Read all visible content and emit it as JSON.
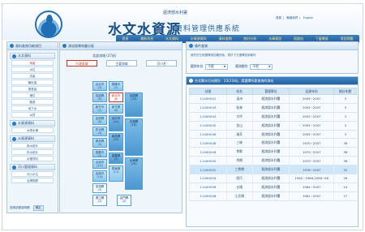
{
  "header": {
    "agency": "經濟部水利署",
    "title_main": "水文水資源",
    "title_sub": "資料管理供應系統",
    "top_links": [
      "首頁",
      "聯絡我們",
      "English"
    ],
    "menu": [
      "首頁",
      "最新消息",
      "水文資料",
      "水資源資料",
      "資料查詢",
      "統計分析",
      "水庫資訊",
      "雨量站",
      "下載專區",
      "常見問題"
    ]
  },
  "nav": {
    "title": "資料查詢功能項目",
    "groups": [
      {
        "title": "水文資料",
        "items": [
          "雨量",
          "水位",
          "流量",
          "輸砂量",
          "蒸發量",
          "潮位",
          "颱風",
          "地下水",
          "水質"
        ],
        "active_index": 0
      },
      {
        "title": "水資源資料",
        "items": [
          "水庫水情"
        ]
      },
      {
        "title": "水資源資料",
        "items": [
          "用水統計",
          "供水統計",
          "水權資料"
        ]
      },
      {
        "title": "河川管理資料",
        "items": [
          "河川水位",
          "治理規劃"
        ]
      }
    ],
    "footer_text": "查詢站號及時間",
    "footer_button": "確定"
  },
  "mid": {
    "title": "測站搜尋地圖分區",
    "basin_label": "北部流域 (27站)",
    "tabs": [
      "行政區域",
      "主要流域",
      "河川名"
    ],
    "active_tab": 0,
    "tiles": [
      {
        "name": "台北市",
        "count": "(3)"
      },
      {
        "name": "基隆市",
        "count": "(1)"
      },
      {
        "name": "桃園縣",
        "count": "(5)"
      },
      {
        "name": "新北市",
        "count": "(8)",
        "selected": true
      },
      {
        "name": "宜蘭縣",
        "count": "(24)"
      },
      {
        "name": "新竹市",
        "count": "(1)"
      },
      {
        "name": "新竹縣",
        "count": "(6)"
      },
      {
        "name": "苗栗縣",
        "count": "(9)"
      },
      {
        "name": "台中市",
        "count": "(10)"
      },
      {
        "name": "花蓮縣",
        "count": "(18)"
      },
      {
        "name": "彰化縣",
        "count": "(4)"
      },
      {
        "name": "南投縣",
        "count": "(15)"
      },
      {
        "name": "雲林縣",
        "count": "(5)"
      },
      {
        "name": "嘉義市",
        "count": "(1)"
      },
      {
        "name": "嘉義縣",
        "count": "(7)"
      },
      {
        "name": "台南市",
        "count": "(12)"
      },
      {
        "name": "高雄市",
        "count": "(14)"
      },
      {
        "name": "台東縣",
        "count": "(20)"
      },
      {
        "name": "屏東縣",
        "count": "(11)"
      },
      {
        "name": "澎湖縣",
        "count": "(3)"
      },
      {
        "name": "連江縣",
        "count": "(2)"
      },
      {
        "name": "金門縣",
        "count": "(2)"
      }
    ]
  },
  "query": {
    "title": "條件查詢",
    "desc": "請先於左側選擇測站類別後，再於下方選擇查詢條件",
    "label1": "觀測年份",
    "value1": "不限",
    "label2": "觀測類別",
    "value2": "不限"
  },
  "table": {
    "title": "台北縣水位站總計：23(23)站，請選擇所要查詢的測站",
    "headers": [
      "站號",
      "站名",
      "管理單位",
      "記錄年份",
      "統計年數"
    ],
    "rows": [
      [
        "1140H041",
        "溪州",
        "經濟部水利署",
        "2005~2007",
        "3"
      ],
      [
        "1140H043",
        "桂林",
        "經濟部水利署",
        "2005~2007",
        "3"
      ],
      [
        "1140H044",
        "大坪",
        "經濟部水利署",
        "2005~2007",
        "3"
      ],
      [
        "1140H045",
        "金山",
        "經濟部水利署",
        "2005~2007",
        "3"
      ],
      [
        "1140H046",
        "瑞芳",
        "經濟部水利署",
        "2005~2007",
        "3"
      ],
      [
        "1140H048",
        "三峽",
        "經濟部水利署",
        "1970~2007",
        "38"
      ],
      [
        "1140H049",
        "鶯歌",
        "經濟部水利署",
        "1970~2007",
        "38"
      ],
      [
        "1140H050",
        "秀朗",
        "經濟部水利署",
        "1970~2007",
        "38"
      ],
      [
        "1140H052",
        "三鶯橋",
        "經濟部水利署",
        "1976~2007",
        "32"
      ],
      [
        "1140H054",
        "屈尺",
        "經濟部水利署",
        "1962~1986,2006~08",
        "28"
      ],
      [
        "1140H056",
        "五堵",
        "經濟部水利署",
        "1984~2007",
        "24"
      ],
      [
        "1140H058",
        "江北橋",
        "經濟部水利署",
        "1981~2007",
        "27"
      ]
    ],
    "highlight_row": 8
  },
  "colors": {
    "accent": "#1f5c9c",
    "title": "#184e84",
    "highlight": "#cfe6f8",
    "selected": "#c0392b"
  }
}
